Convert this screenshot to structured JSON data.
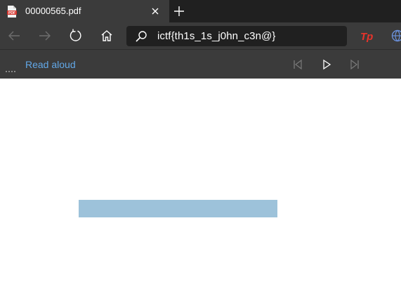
{
  "tab": {
    "title": "00000565.pdf",
    "pdf_badge": "PDF",
    "icon": "pdf-file-icon"
  },
  "toolbar": {
    "address_text": "ictf{th1s_1s_j0hn_c3n@}",
    "extension_badge": "Tp",
    "extension_color": "#e8332a"
  },
  "read_aloud": {
    "label": "Read aloud",
    "label_color": "#62a8e8"
  },
  "document": {
    "highlight_color": "#9dc2da"
  }
}
